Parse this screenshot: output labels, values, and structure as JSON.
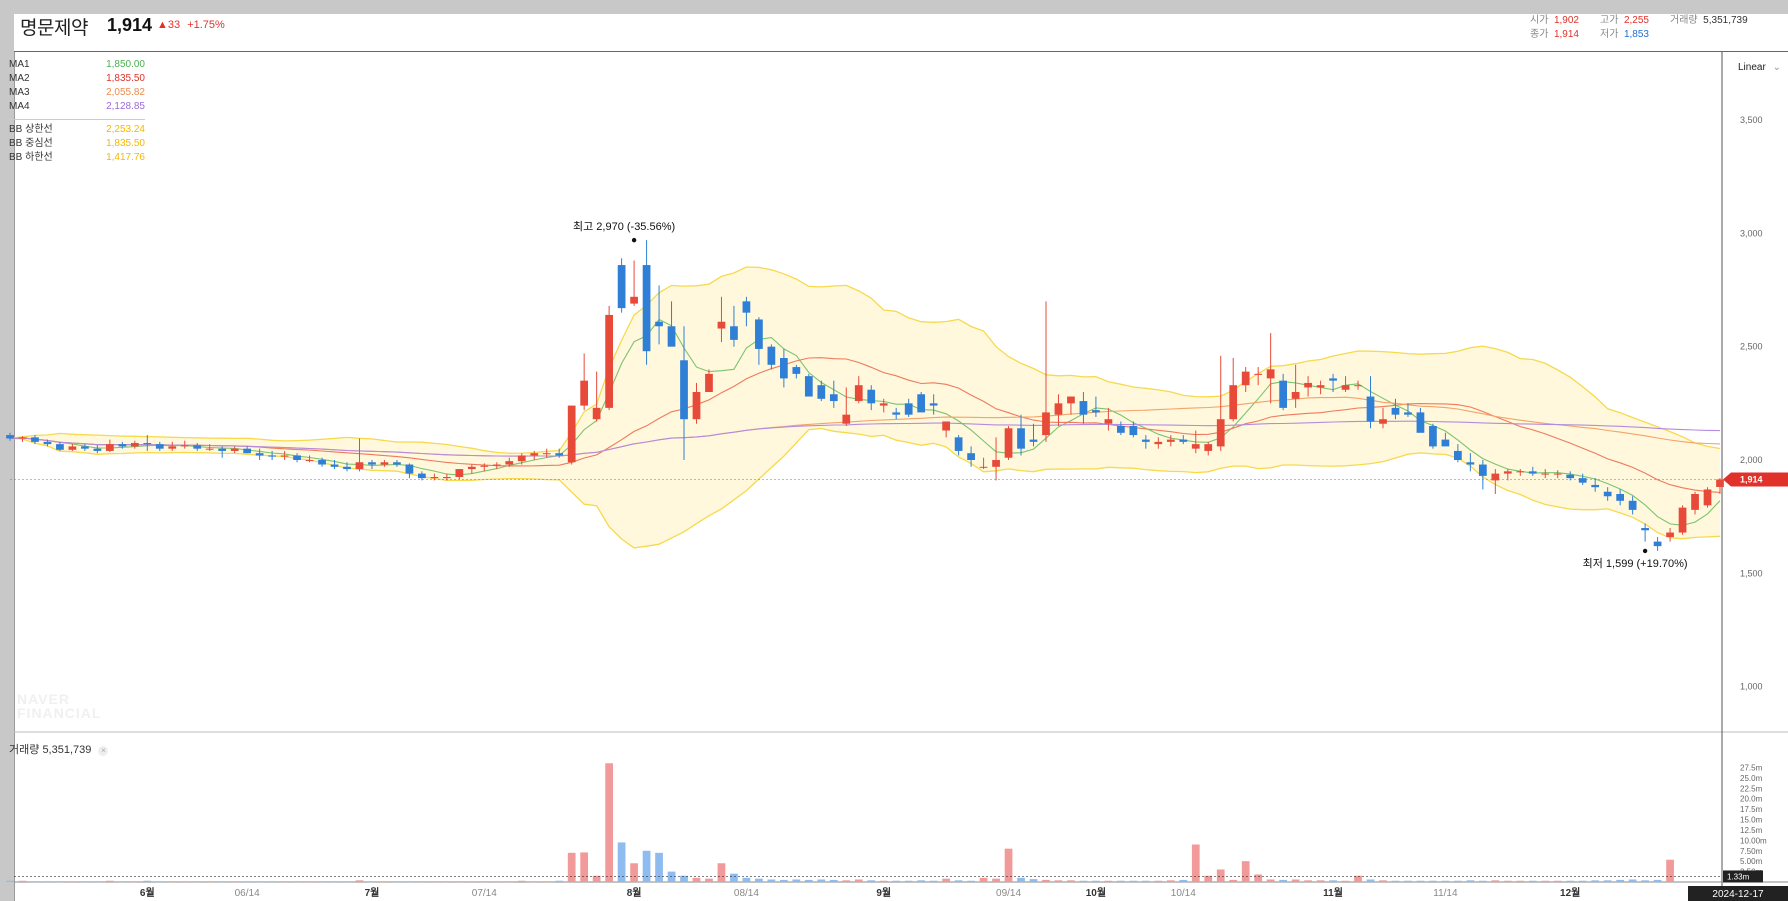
{
  "header": {
    "stock_name": "명문제약",
    "price": "1,914",
    "change": "▲33",
    "change_pct": "+1.75%",
    "open_label": "시가",
    "open": "1,902",
    "high_label": "고가",
    "high": "2,255",
    "volume_label": "거래량",
    "volume": "5,351,739",
    "close_label": "종가",
    "close": "1,914",
    "low_label": "저가",
    "low": "1,853"
  },
  "legend": {
    "items": [
      {
        "name": "MA1",
        "value": "1,850.00",
        "color": "#4caf50"
      },
      {
        "name": "MA2",
        "value": "1,835.50",
        "color": "#e0322b"
      },
      {
        "name": "MA3",
        "value": "2,055.82",
        "color": "#f08a4b"
      },
      {
        "name": "MA4",
        "value": "2,128.85",
        "color": "#9c6bd6"
      }
    ],
    "bb": [
      {
        "name": "BB 상한선",
        "value": "2,253.24",
        "color": "#f5b800"
      },
      {
        "name": "BB 중심선",
        "value": "1,835.50",
        "color": "#f5b800"
      },
      {
        "name": "BB 하한선",
        "value": "1,417.76",
        "color": "#f5b800"
      }
    ]
  },
  "scale_button": "Linear",
  "volume_panel": {
    "label": "거래량",
    "value": "5,351,739"
  },
  "watermark": {
    "line1": "NAVER",
    "line2": "FINANCIAL"
  },
  "colors": {
    "up": "#e84a3a",
    "down": "#2f7fd6",
    "up_vol": "#f29a9a",
    "down_vol": "#8fbcf0",
    "band_fill": "#fff8dc",
    "band_line": "#f7d94c"
  },
  "chart_data": {
    "type": "candlestick",
    "ylim": [
      800,
      3800
    ],
    "y_ticks": [
      1000,
      1500,
      2000,
      2500,
      3000,
      3500
    ],
    "y_tick_labels": [
      "1,000",
      "1,500",
      "2,000",
      "2,500",
      "3,000",
      "3,500"
    ],
    "x_labels": [
      {
        "label": "6월",
        "major": true,
        "i": 11
      },
      {
        "label": "06/14",
        "major": false,
        "i": 19
      },
      {
        "label": "7월",
        "major": true,
        "i": 29
      },
      {
        "label": "07/14",
        "major": false,
        "i": 38
      },
      {
        "label": "8월",
        "major": true,
        "i": 50
      },
      {
        "label": "08/14",
        "major": false,
        "i": 59
      },
      {
        "label": "9월",
        "major": true,
        "i": 70
      },
      {
        "label": "09/14",
        "major": false,
        "i": 80
      },
      {
        "label": "10월",
        "major": true,
        "i": 87
      },
      {
        "label": "10/14",
        "major": false,
        "i": 94
      },
      {
        "label": "11월",
        "major": true,
        "i": 106
      },
      {
        "label": "11/14",
        "major": false,
        "i": 115
      },
      {
        "label": "12월",
        "major": true,
        "i": 125
      }
    ],
    "current_date": "2024-12-17",
    "last_price_tag": "1,914",
    "annotations": [
      {
        "label": "최고 2,970 (-35.56%)",
        "i": 50,
        "price": 2970
      },
      {
        "label": "최저 1,599 (+19.70%)",
        "i": 131,
        "price": 1599
      }
    ],
    "candles": [
      [
        2110,
        2120,
        2085,
        2095
      ],
      [
        2095,
        2105,
        2080,
        2100
      ],
      [
        2100,
        2110,
        2070,
        2080
      ],
      [
        2080,
        2090,
        2060,
        2070
      ],
      [
        2070,
        2080,
        2040,
        2045
      ],
      [
        2045,
        2070,
        2040,
        2060
      ],
      [
        2060,
        2070,
        2040,
        2050
      ],
      [
        2050,
        2065,
        2030,
        2040
      ],
      [
        2040,
        2090,
        2035,
        2070
      ],
      [
        2070,
        2080,
        2050,
        2060
      ],
      [
        2060,
        2085,
        2050,
        2075
      ],
      [
        2075,
        2110,
        2040,
        2070
      ],
      [
        2070,
        2080,
        2040,
        2050
      ],
      [
        2050,
        2080,
        2040,
        2060
      ],
      [
        2060,
        2085,
        2050,
        2065
      ],
      [
        2065,
        2075,
        2040,
        2050
      ],
      [
        2050,
        2070,
        2040,
        2050
      ],
      [
        2050,
        2060,
        2010,
        2040
      ],
      [
        2040,
        2060,
        2030,
        2050
      ],
      [
        2050,
        2060,
        2030,
        2030
      ],
      [
        2030,
        2050,
        2000,
        2020
      ],
      [
        2020,
        2040,
        2000,
        2015
      ],
      [
        2015,
        2040,
        2000,
        2020
      ],
      [
        2020,
        2030,
        1990,
        2000
      ],
      [
        2000,
        2020,
        1990,
        2000
      ],
      [
        2000,
        2010,
        1970,
        1980
      ],
      [
        1980,
        2000,
        1960,
        1970
      ],
      [
        1970,
        1990,
        1950,
        1960
      ],
      [
        1960,
        2095,
        1950,
        1990
      ],
      [
        1990,
        2000,
        1960,
        1980
      ],
      [
        1980,
        2000,
        1970,
        1990
      ],
      [
        1990,
        2000,
        1970,
        1980
      ],
      [
        1980,
        1985,
        1920,
        1940
      ],
      [
        1940,
        1950,
        1910,
        1920
      ],
      [
        1920,
        1940,
        1910,
        1925
      ],
      [
        1920,
        1940,
        1910,
        1925
      ],
      [
        1925,
        1960,
        1915,
        1960
      ],
      [
        1960,
        1980,
        1940,
        1970
      ],
      [
        1970,
        1985,
        1950,
        1975
      ],
      [
        1975,
        1990,
        1960,
        1980
      ],
      [
        1980,
        2010,
        1970,
        1995
      ],
      [
        1995,
        2030,
        1980,
        2020
      ],
      [
        2020,
        2040,
        2000,
        2030
      ],
      [
        2030,
        2050,
        2010,
        2030
      ],
      [
        2030,
        2050,
        2010,
        2020
      ],
      [
        1990,
        2240,
        1980,
        2240
      ],
      [
        2240,
        2470,
        2220,
        2350
      ],
      [
        2180,
        2390,
        2170,
        2230
      ],
      [
        2230,
        2680,
        2220,
        2640
      ],
      [
        2860,
        2890,
        2650,
        2670
      ],
      [
        2690,
        2880,
        2680,
        2720
      ],
      [
        2860,
        2970,
        2420,
        2480
      ],
      [
        2610,
        2770,
        2510,
        2590
      ],
      [
        2590,
        2700,
        2540,
        2500
      ],
      [
        2440,
        2590,
        2000,
        2180
      ],
      [
        2180,
        2340,
        2160,
        2300
      ],
      [
        2300,
        2400,
        2300,
        2380
      ],
      [
        2580,
        2720,
        2520,
        2610
      ],
      [
        2590,
        2680,
        2500,
        2530
      ],
      [
        2700,
        2720,
        2590,
        2650
      ],
      [
        2620,
        2630,
        2420,
        2490
      ],
      [
        2500,
        2510,
        2400,
        2420
      ],
      [
        2450,
        2490,
        2320,
        2360
      ],
      [
        2410,
        2420,
        2360,
        2380
      ],
      [
        2370,
        2380,
        2280,
        2280
      ],
      [
        2330,
        2350,
        2260,
        2270
      ],
      [
        2290,
        2350,
        2230,
        2260
      ],
      [
        2160,
        2320,
        2150,
        2200
      ],
      [
        2260,
        2370,
        2250,
        2330
      ],
      [
        2310,
        2330,
        2220,
        2250
      ],
      [
        2240,
        2270,
        2210,
        2250
      ],
      [
        2210,
        2230,
        2180,
        2200
      ],
      [
        2250,
        2270,
        2190,
        2200
      ],
      [
        2290,
        2300,
        2240,
        2210
      ],
      [
        2250,
        2290,
        2200,
        2240
      ],
      [
        2130,
        2160,
        2100,
        2170
      ],
      [
        2100,
        2110,
        2020,
        2040
      ],
      [
        2030,
        2060,
        1970,
        2000
      ],
      [
        1970,
        2010,
        1960,
        1970
      ],
      [
        1970,
        2100,
        1910,
        2000
      ],
      [
        2010,
        2150,
        2000,
        2140
      ],
      [
        2140,
        2200,
        2020,
        2050
      ],
      [
        2090,
        2160,
        2060,
        2080
      ],
      [
        2110,
        2700,
        2080,
        2210
      ],
      [
        2200,
        2290,
        2150,
        2250
      ],
      [
        2250,
        2280,
        2200,
        2280
      ],
      [
        2260,
        2300,
        2160,
        2200
      ],
      [
        2220,
        2280,
        2190,
        2210
      ],
      [
        2160,
        2230,
        2130,
        2180
      ],
      [
        2150,
        2170,
        2110,
        2120
      ],
      [
        2150,
        2170,
        2100,
        2110
      ],
      [
        2090,
        2110,
        2050,
        2080
      ],
      [
        2070,
        2100,
        2050,
        2080
      ],
      [
        2080,
        2110,
        2060,
        2090
      ],
      [
        2090,
        2110,
        2070,
        2080
      ],
      [
        2050,
        2130,
        2030,
        2070
      ],
      [
        2040,
        2080,
        2020,
        2070
      ],
      [
        2060,
        2460,
        2040,
        2180
      ],
      [
        2180,
        2450,
        2170,
        2330
      ],
      [
        2330,
        2410,
        2300,
        2390
      ],
      [
        2380,
        2410,
        2330,
        2380
      ],
      [
        2360,
        2560,
        2250,
        2400
      ],
      [
        2350,
        2380,
        2220,
        2230
      ],
      [
        2270,
        2420,
        2230,
        2300
      ],
      [
        2320,
        2370,
        2280,
        2340
      ],
      [
        2320,
        2350,
        2290,
        2330
      ],
      [
        2360,
        2380,
        2300,
        2350
      ],
      [
        2310,
        2370,
        2300,
        2330
      ],
      [
        2330,
        2350,
        2310,
        2330
      ],
      [
        2280,
        2370,
        2140,
        2170
      ],
      [
        2160,
        2230,
        2140,
        2180
      ],
      [
        2230,
        2270,
        2180,
        2200
      ],
      [
        2210,
        2250,
        2190,
        2200
      ],
      [
        2210,
        2230,
        2190,
        2120
      ],
      [
        2150,
        2160,
        2050,
        2060
      ],
      [
        2090,
        2120,
        2070,
        2060
      ],
      [
        2040,
        2070,
        1990,
        2000
      ],
      [
        1990,
        2030,
        1950,
        1980
      ],
      [
        1980,
        2000,
        1870,
        1930
      ],
      [
        1910,
        1960,
        1850,
        1940
      ],
      [
        1940,
        1960,
        1910,
        1950
      ],
      [
        1950,
        1960,
        1930,
        1950
      ],
      [
        1950,
        1970,
        1930,
        1940
      ],
      [
        1940,
        1960,
        1920,
        1940
      ],
      [
        1940,
        1955,
        1920,
        1940
      ],
      [
        1935,
        1950,
        1910,
        1920
      ],
      [
        1920,
        1940,
        1890,
        1900
      ],
      [
        1890,
        1920,
        1860,
        1880
      ],
      [
        1860,
        1880,
        1820,
        1840
      ],
      [
        1850,
        1870,
        1800,
        1820
      ],
      [
        1820,
        1840,
        1760,
        1780
      ],
      [
        1700,
        1720,
        1640,
        1690
      ],
      [
        1640,
        1660,
        1599,
        1620
      ],
      [
        1660,
        1700,
        1640,
        1680
      ],
      [
        1680,
        1800,
        1670,
        1790
      ],
      [
        1780,
        1860,
        1760,
        1850
      ],
      [
        1800,
        1880,
        1790,
        1870
      ],
      [
        1881,
        1920,
        1850,
        1914
      ]
    ],
    "volume": [
      0.3,
      0.3,
      0.2,
      0.2,
      0.2,
      0.2,
      0.2,
      0.2,
      0.3,
      0.2,
      0.2,
      0.3,
      0.2,
      0.2,
      0.2,
      0.2,
      0.2,
      0.2,
      0.2,
      0.2,
      0.2,
      0.2,
      0.2,
      0.2,
      0.2,
      0.2,
      0.2,
      0.2,
      0.4,
      0.2,
      0.2,
      0.2,
      0.2,
      0.2,
      0.2,
      0.2,
      0.2,
      0.2,
      0.2,
      0.2,
      0.2,
      0.3,
      0.2,
      0.2,
      0.3,
      7.0,
      7.1,
      1.5,
      28.5,
      9.5,
      4.5,
      7.5,
      7.0,
      2.5,
      1.5,
      1.0,
      0.8,
      4.5,
      2.0,
      1.0,
      0.8,
      0.6,
      0.5,
      0.6,
      0.5,
      0.6,
      0.5,
      0.4,
      0.6,
      0.4,
      0.3,
      0.3,
      0.3,
      0.4,
      0.3,
      0.8,
      0.4,
      0.3,
      1.0,
      0.8,
      8.0,
      1.0,
      0.7,
      0.5,
      0.4,
      0.4,
      0.3,
      0.3,
      0.3,
      0.3,
      0.3,
      0.3,
      0.3,
      0.4,
      0.5,
      9.0,
      1.5,
      3.0,
      0.5,
      5.0,
      1.8,
      0.6,
      0.5,
      0.6,
      0.4,
      0.4,
      0.4,
      0.3,
      1.5,
      0.6,
      0.4,
      0.3,
      0.3,
      0.3,
      0.3,
      0.3,
      0.3,
      0.4,
      0.3,
      0.4,
      0.3,
      0.3,
      0.3,
      0.3,
      0.3,
      0.3,
      0.3,
      0.4,
      0.4,
      0.5,
      0.6,
      0.4,
      0.5,
      5.35
    ],
    "volume_ticks": [
      "27.5m",
      "25.0m",
      "22.5m",
      "20.0m",
      "17.5m",
      "15.0m",
      "12.5m",
      "10.00m",
      "7.50m",
      "5.00m",
      "2.50m"
    ],
    "volume_tick_values": [
      27.5,
      25,
      22.5,
      20,
      17.5,
      15,
      12.5,
      10,
      7.5,
      5,
      2.5
    ],
    "current_volume_tag": "1.33m"
  }
}
